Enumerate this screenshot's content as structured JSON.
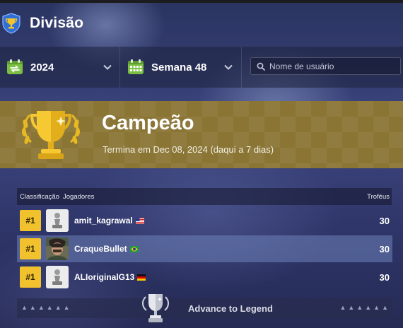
{
  "header": {
    "title": "Divisão",
    "icon": "trophy-shield-icon"
  },
  "filters": {
    "year": {
      "label": "2024",
      "icon": "calendar-green-icon"
    },
    "week": {
      "label": "Semana 48",
      "icon": "calendar-green-icon"
    },
    "search": {
      "placeholder": "Nome de usuário",
      "value": "",
      "icon": "search-icon"
    }
  },
  "banner": {
    "title": "Campeão",
    "subtitle": "Termina em Dec 08, 2024 (daqui a 7 dias)",
    "icon": "gold-trophy-icon",
    "color": "#8a7535"
  },
  "table": {
    "headers": {
      "rank": "Classificação",
      "players": "Jogadores",
      "trophies": "Troféus"
    },
    "rows": [
      {
        "rank": "#1",
        "username": "amit_kagrawal",
        "country": "US",
        "trophies": "30",
        "highlighted": false
      },
      {
        "rank": "#1",
        "username": "CraqueBullet",
        "country": "BR",
        "trophies": "30",
        "highlighted": true
      },
      {
        "rank": "#1",
        "username": "ALIoriginalG13",
        "country": "DE",
        "trophies": "30",
        "highlighted": false
      }
    ]
  },
  "promotion": {
    "label": "Advance to Legend",
    "icon": "silver-trophy-icon"
  },
  "colors": {
    "rank_badge": "#f2c12e",
    "highlight_row": "#6e82b9",
    "accent_green": "#7bc043"
  }
}
